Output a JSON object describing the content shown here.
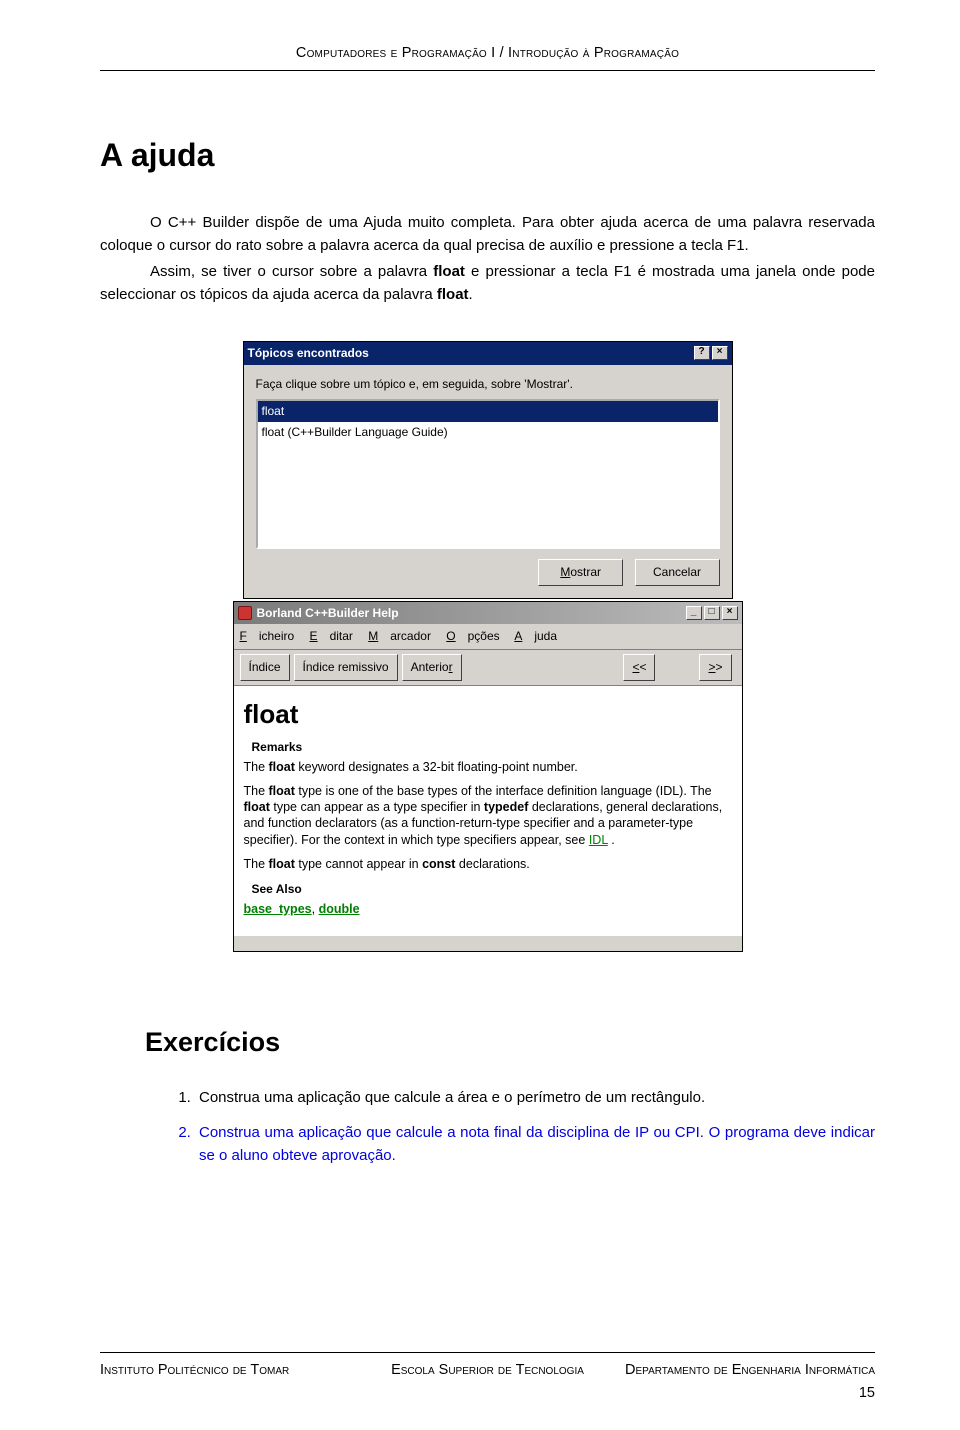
{
  "header": "Computadores e Programação I / Introdução à Programação",
  "title": "A ajuda",
  "p1": "O C++ Builder dispõe de uma Ajuda muito completa. Para obter ajuda acerca de uma palavra reservada coloque o cursor do rato sobre a palavra acerca da qual precisa de auxílio e pressione a tecla F1.",
  "p2_a": "Assim, se tiver o cursor sobre a palavra ",
  "p2_b": "float",
  "p2_c": " e pressionar a tecla F1 é mostrada uma janela onde pode seleccionar os tópicos da ajuda acerca da palavra ",
  "p2_d": "float",
  "p2_e": ".",
  "dlg": {
    "title": "Tópicos encontrados",
    "label": "Faça clique sobre um tópico e, em seguida, sobre 'Mostrar'.",
    "items": [
      "float",
      "float  (C++Builder Language Guide)"
    ],
    "btn_show": "Mostrar",
    "btn_cancel": "Cancelar"
  },
  "hw": {
    "title": "Borland C++Builder Help",
    "menu": [
      "Ficheiro",
      "Editar",
      "Marcador",
      "Opções",
      "Ajuda"
    ],
    "toolbar": [
      "Índice",
      "Índice remissivo",
      "Anterior",
      "<<",
      ">>"
    ],
    "h1": "float",
    "h2a": "Remarks",
    "p1_a": "The ",
    "p1_b": "float",
    "p1_c": " keyword designates a 32-bit floating-point number.",
    "p2_a": "The ",
    "p2_b": "float",
    "p2_c": " type is one of the base types of the interface definition language (IDL). The ",
    "p2_d": "float",
    "p2_e": " type can appear as a type specifier in ",
    "p2_f": "typedef",
    "p2_g": " declarations, general declarations, and function declarators (as a function-return-type specifier and a parameter-type specifier). For the context in which type specifiers appear, see ",
    "p2_link": "IDL",
    "p2_h": " .",
    "p3_a": "The ",
    "p3_b": "float",
    "p3_c": " type cannot appear in ",
    "p3_d": "const",
    "p3_e": " declarations.",
    "h2b": "See Also",
    "see_a": "base_types",
    "see_sep": ", ",
    "see_b": "double"
  },
  "ex_title": "Exercícios",
  "ex": [
    "Construa uma aplicação que calcule a área e o perímetro de um rectângulo.",
    "Construa uma aplicação que calcule a nota final da disciplina de IP ou CPI. O programa deve indicar se o aluno obteve aprovação."
  ],
  "footer": {
    "left": "Instituto Politécnico de Tomar",
    "center": "Escola Superior de Tecnologia",
    "right": "Departamento de Engenharia Informática  15"
  }
}
